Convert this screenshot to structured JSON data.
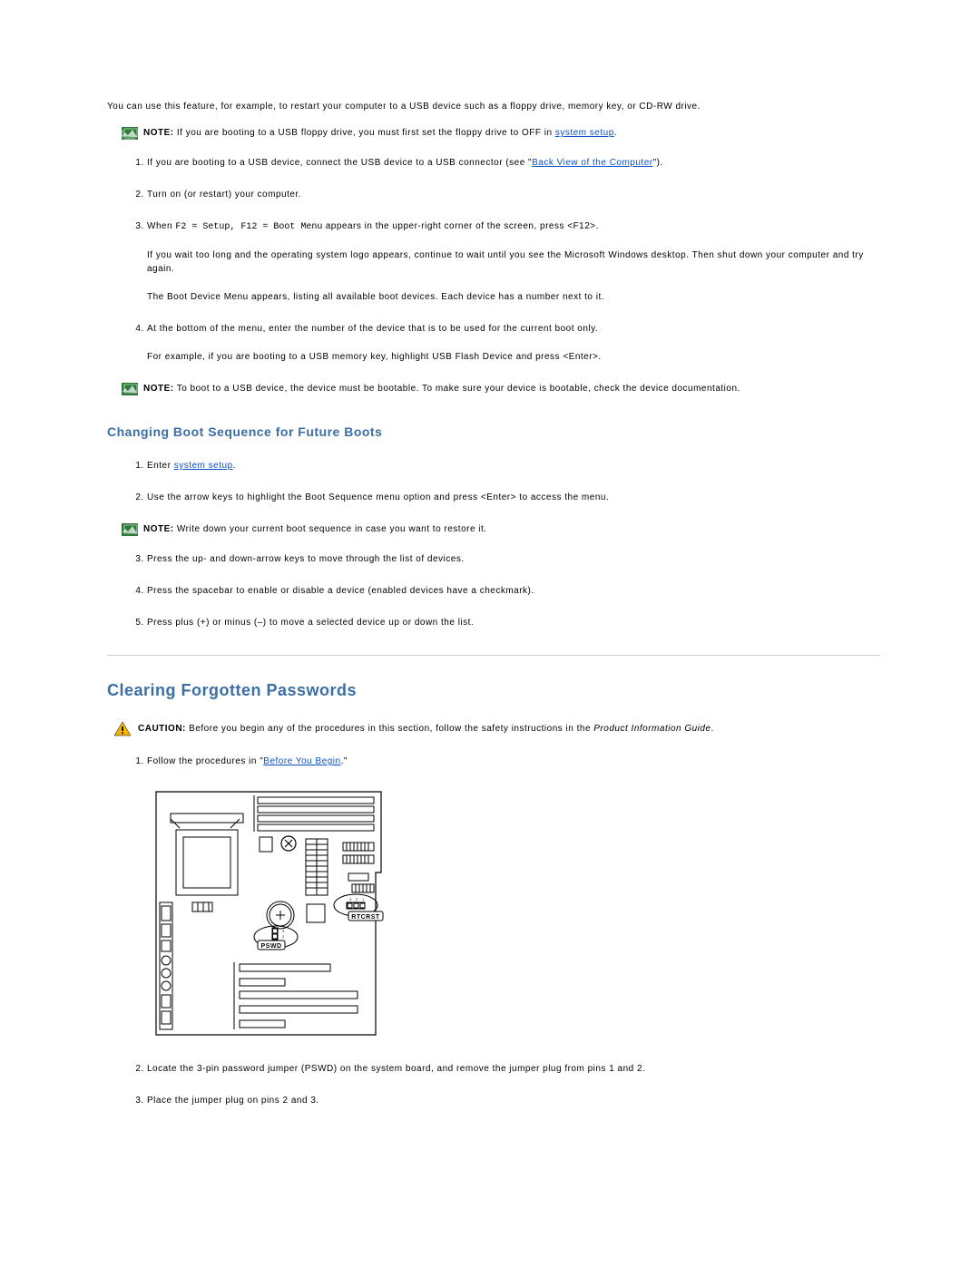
{
  "intro": "You can use this feature, for example, to restart your computer to a USB device such as a floppy drive, memory key, or CD-RW drive.",
  "note1_label": "NOTE:",
  "note1_text_a": " If you are booting to a USB floppy drive, you must first set the floppy drive to OFF in ",
  "note1_link": "system setup",
  "note1_text_b": ".",
  "steps_a": {
    "s1_a": "If you are booting to a USB device, connect the USB device to a USB connector (see \"",
    "s1_link": "Back View of the Computer",
    "s1_b": "\").",
    "s2": "Turn on (or restart) your computer.",
    "s3_a": "When ",
    "s3_code": "F2 = Setup, F12 = Boot Menu",
    "s3_b": " appears in the upper-right corner of the screen, press <F12>.",
    "s3_sub1": "If you wait too long and the operating system logo appears, continue to wait until you see the Microsoft Windows desktop. Then shut down your computer and try again.",
    "s3_sub2": "The Boot Device Menu appears, listing all available boot devices. Each device has a number next to it.",
    "s4": "At the bottom of the menu, enter the number of the device that is to be used for the current boot only.",
    "s4_sub1": "For example, if you are booting to a USB memory key, highlight USB Flash Device and press <Enter>."
  },
  "note2_label": "NOTE:",
  "note2_text": " To boot to a USB device, the device must be bootable. To make sure your device is bootable, check the device documentation.",
  "heading_change": "Changing Boot Sequence for Future Boots",
  "steps_b": {
    "s1_a": "Enter ",
    "s1_link": "system setup",
    "s1_b": ".",
    "s2": "Use the arrow keys to highlight the Boot Sequence menu option and press <Enter> to access the menu."
  },
  "note3_label": "NOTE:",
  "note3_text": " Write down your current boot sequence in case you want to restore it.",
  "steps_c": {
    "s3": "Press the up- and down-arrow keys to move through the list of devices.",
    "s4": "Press the spacebar to enable or disable a device (enabled devices have a checkmark).",
    "s5": "Press plus (+) or minus (–) to move a selected device up or down the list."
  },
  "heading_clear": "Clearing Forgotten Passwords",
  "caution_label": "CAUTION:",
  "caution_text_a": " Before you begin any of the procedures in this section, follow the safety instructions in the ",
  "caution_italic": "Product Information Guide",
  "caution_text_b": ".",
  "steps_d": {
    "s1_a": "Follow the procedures in \"",
    "s1_link": "Before You Begin",
    "s1_b": ".\"",
    "s2": "Locate the 3-pin password jumper (PSWD) on the system board, and remove the jumper plug from pins 1 and 2.",
    "s3": "Place the jumper plug on pins 2 and 3."
  },
  "diagram": {
    "pswd_label": "PSWD",
    "rtcrst_label": "RTCRST",
    "pswd_pins": "3 2 1",
    "rtcrst_pins": "3 2 1"
  }
}
